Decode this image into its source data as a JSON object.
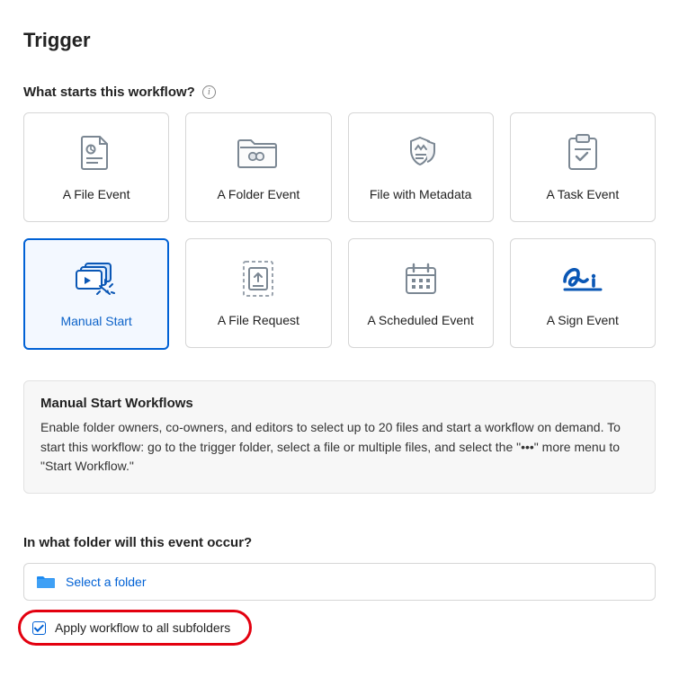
{
  "page_title": "Trigger",
  "section1": {
    "label": "What starts this workflow?"
  },
  "triggers": [
    {
      "label": "A File Event",
      "selected": false
    },
    {
      "label": "A Folder Event",
      "selected": false
    },
    {
      "label": "File with Metadata",
      "selected": false
    },
    {
      "label": "A Task Event",
      "selected": false
    },
    {
      "label": "Manual Start",
      "selected": true
    },
    {
      "label": "A File Request",
      "selected": false
    },
    {
      "label": "A Scheduled Event",
      "selected": false
    },
    {
      "label": "A Sign Event",
      "selected": false
    }
  ],
  "info_box": {
    "title": "Manual Start Workflows",
    "body": "Enable folder owners, co-owners, and editors to select up to 20 files and start a workflow on demand. To start this workflow: go to the trigger folder, select a file or multiple files, and select the \"•••\" more menu to \"Start Workflow.\""
  },
  "section2": {
    "label": "In what folder will this event occur?"
  },
  "folder_picker": {
    "placeholder": "Select a folder"
  },
  "subfolders_checkbox": {
    "label": "Apply workflow to all subfolders",
    "checked": true
  }
}
